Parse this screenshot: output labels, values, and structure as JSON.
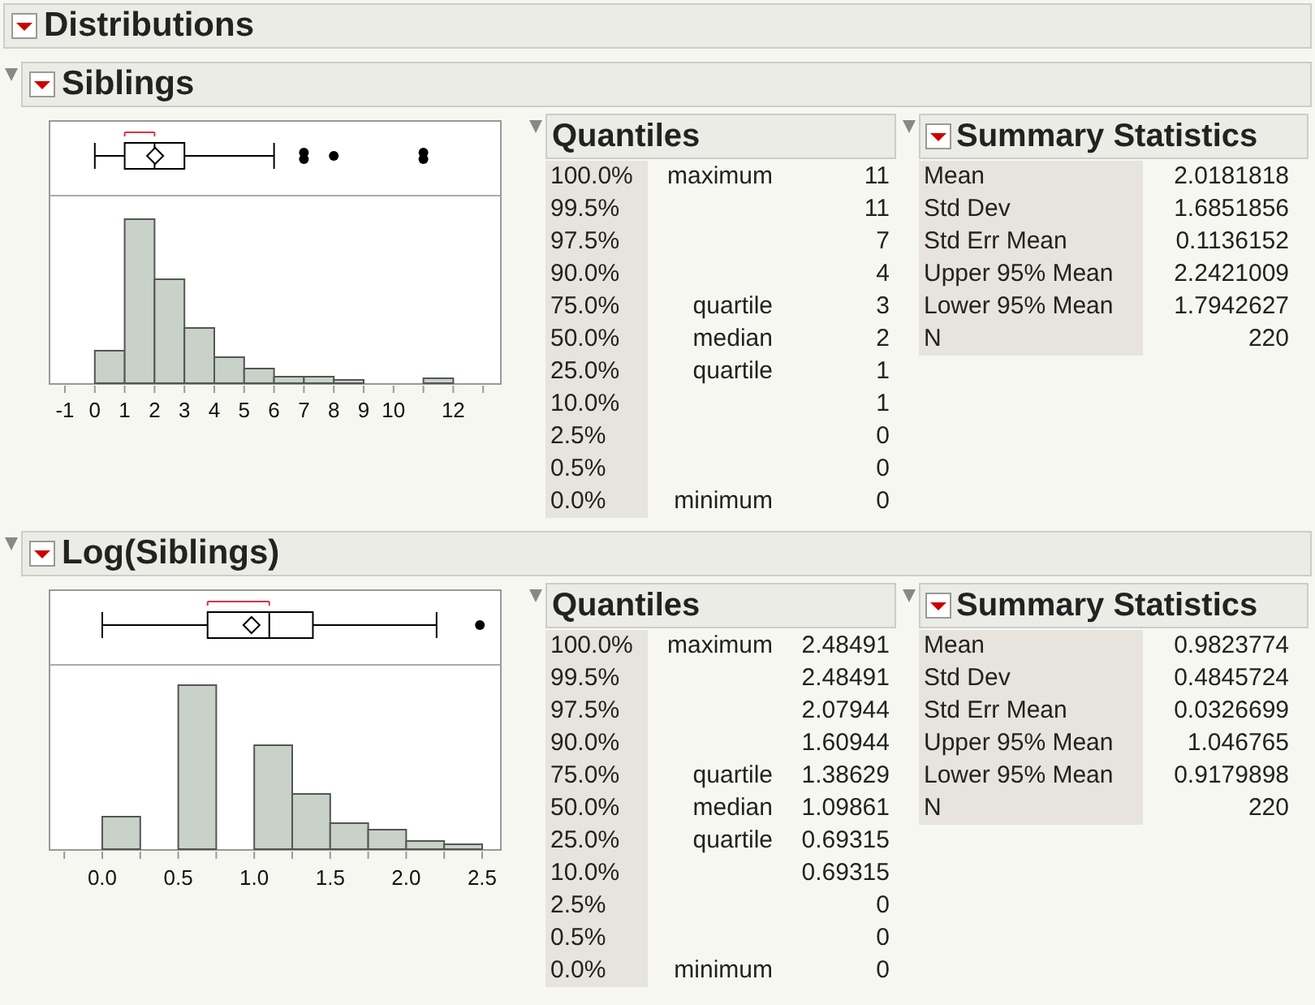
{
  "title": "Distributions",
  "distributions": [
    {
      "name": "Siblings",
      "expanded": true,
      "axis_labels": [
        "-1",
        "0",
        "1",
        "2",
        "3",
        "4",
        "5",
        "6",
        "7",
        "8",
        "9",
        "10",
        "12"
      ],
      "quantiles": {
        "title": "Quantiles",
        "expanded": true,
        "rows": [
          {
            "percent": "100.0%",
            "label": "maximum",
            "value": "11"
          },
          {
            "percent": "99.5%",
            "label": "",
            "value": "11"
          },
          {
            "percent": "97.5%",
            "label": "",
            "value": "7"
          },
          {
            "percent": "90.0%",
            "label": "",
            "value": "4"
          },
          {
            "percent": "75.0%",
            "label": "quartile",
            "value": "3"
          },
          {
            "percent": "50.0%",
            "label": "median",
            "value": "2"
          },
          {
            "percent": "25.0%",
            "label": "quartile",
            "value": "1"
          },
          {
            "percent": "10.0%",
            "label": "",
            "value": "1"
          },
          {
            "percent": "2.5%",
            "label": "",
            "value": "0"
          },
          {
            "percent": "0.5%",
            "label": "",
            "value": "0"
          },
          {
            "percent": "0.0%",
            "label": "minimum",
            "value": "0"
          }
        ]
      },
      "summary": {
        "title": "Summary Statistics",
        "expanded": true,
        "rows": [
          {
            "label": "Mean",
            "value": "2.0181818"
          },
          {
            "label": "Std Dev",
            "value": "1.6851856"
          },
          {
            "label": "Std Err Mean",
            "value": "0.1136152"
          },
          {
            "label": "Upper 95% Mean",
            "value": "2.2421009"
          },
          {
            "label": "Lower 95% Mean",
            "value": "1.7942627"
          },
          {
            "label": "N",
            "value": "220"
          }
        ]
      }
    },
    {
      "name": "Log(Siblings)",
      "expanded": true,
      "axis_labels": [
        "0.0",
        "0.5",
        "1.0",
        "1.5",
        "2.0",
        "2.5"
      ],
      "quantiles": {
        "title": "Quantiles",
        "expanded": true,
        "rows": [
          {
            "percent": "100.0%",
            "label": "maximum",
            "value": "2.48491"
          },
          {
            "percent": "99.5%",
            "label": "",
            "value": "2.48491"
          },
          {
            "percent": "97.5%",
            "label": "",
            "value": "2.07944"
          },
          {
            "percent": "90.0%",
            "label": "",
            "value": "1.60944"
          },
          {
            "percent": "75.0%",
            "label": "quartile",
            "value": "1.38629"
          },
          {
            "percent": "50.0%",
            "label": "median",
            "value": "1.09861"
          },
          {
            "percent": "25.0%",
            "label": "quartile",
            "value": "0.69315"
          },
          {
            "percent": "10.0%",
            "label": "",
            "value": "0.69315"
          },
          {
            "percent": "2.5%",
            "label": "",
            "value": "0"
          },
          {
            "percent": "0.5%",
            "label": "",
            "value": "0"
          },
          {
            "percent": "0.0%",
            "label": "minimum",
            "value": "0"
          }
        ]
      },
      "summary": {
        "title": "Summary Statistics",
        "expanded": true,
        "rows": [
          {
            "label": "Mean",
            "value": "0.9823774"
          },
          {
            "label": "Std Dev",
            "value": "0.4845724"
          },
          {
            "label": "Std Err Mean",
            "value": "0.0326699"
          },
          {
            "label": "Upper 95% Mean",
            "value": "1.046765"
          },
          {
            "label": "Lower 95% Mean",
            "value": "0.9179898"
          },
          {
            "label": "N",
            "value": "220"
          }
        ]
      }
    }
  ]
}
